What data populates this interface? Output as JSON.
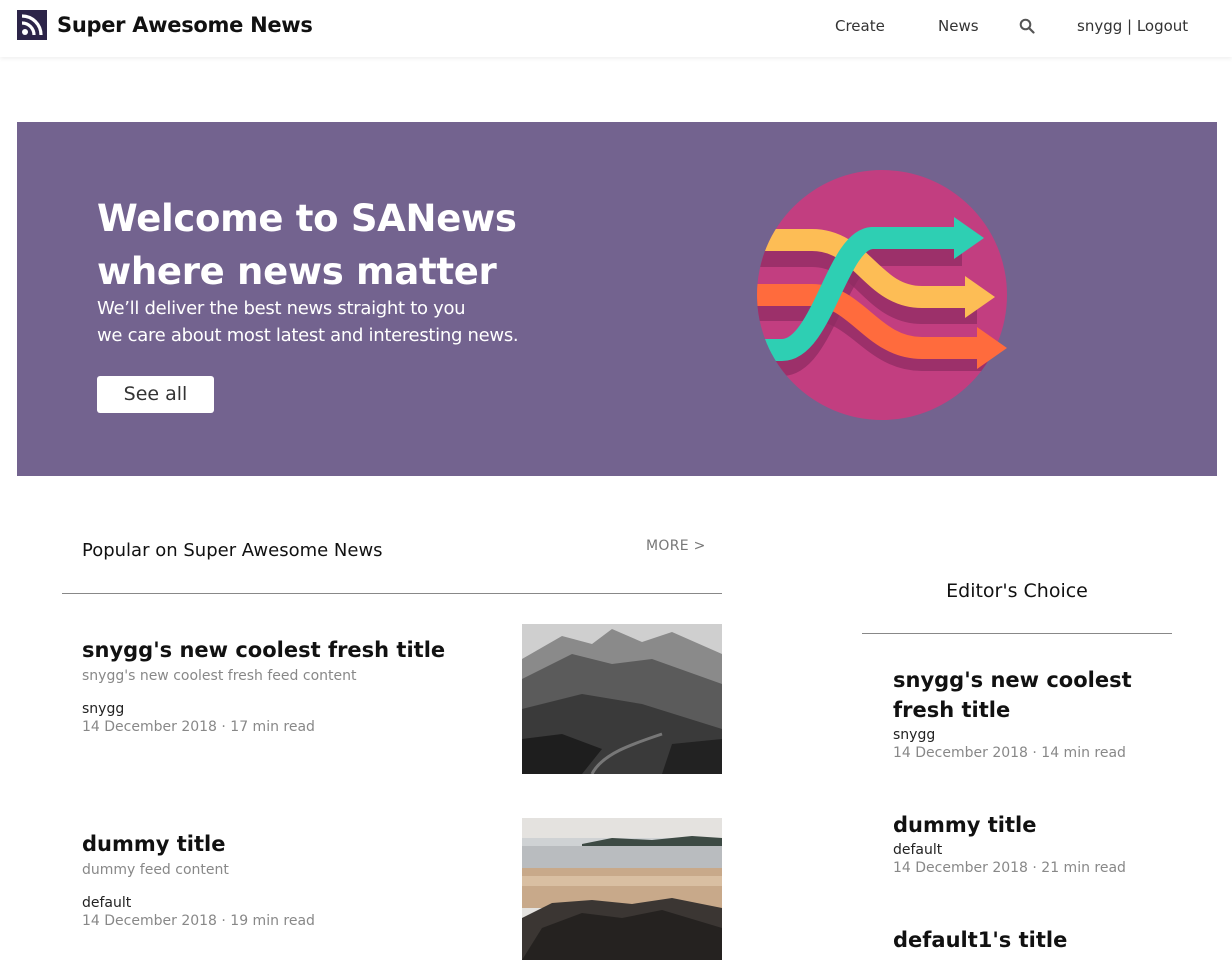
{
  "header": {
    "brand": "Super Awesome News",
    "logo_icon": "rss-icon",
    "nav": {
      "create": "Create",
      "news": "News",
      "search_icon": "search-icon",
      "user": "snygg | Logout"
    }
  },
  "hero": {
    "title_line1": "Welcome to SANews",
    "title_line2": "where news matter",
    "sub_line1": "We’ll deliver the best news straight to you",
    "sub_line2": "we care about most latest and interesting news.",
    "button": "See all",
    "illustration": "crossing-arrows-icon",
    "colors": {
      "background": "#73638f",
      "circle": "#c23e80",
      "arrow_teal": "#2ecfb3",
      "arrow_yellow": "#fdbd55",
      "arrow_orange": "#ff6b3d"
    }
  },
  "popular": {
    "title": "Popular on Super Awesome News",
    "more": "MORE >",
    "articles": [
      {
        "title": "snygg's new coolest fresh title",
        "desc": "snygg's new coolest fresh feed content",
        "author": "snygg",
        "meta": "14 December 2018 · 17 min read",
        "image": "mountain-photo"
      },
      {
        "title": "dummy title",
        "desc": "dummy feed content",
        "author": "default",
        "meta": "14 December 2018 · 19 min read",
        "image": "beach-photo"
      }
    ]
  },
  "editors_choice": {
    "title": "Editor's Choice",
    "items": [
      {
        "title": "snygg's new coolest fresh title",
        "author": "snygg",
        "meta": "14 December 2018 · 14 min read"
      },
      {
        "title": "dummy title",
        "author": "default",
        "meta": "14 December 2018 · 21 min read"
      },
      {
        "title": "default1's title"
      }
    ]
  }
}
